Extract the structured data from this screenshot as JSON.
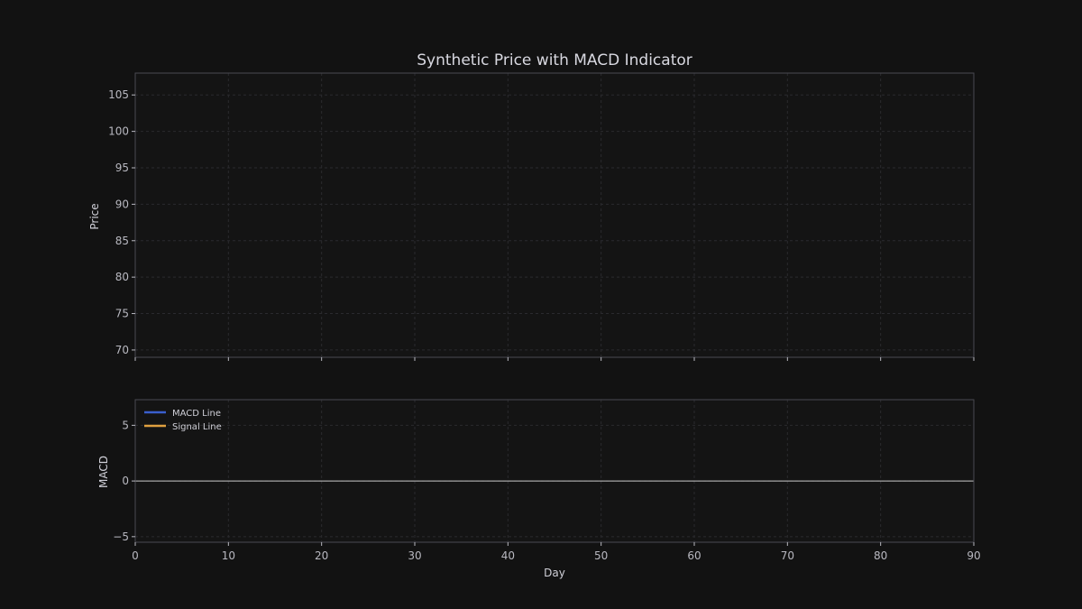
{
  "chart_data": [
    {
      "type": "line",
      "title": "Synthetic Price with MACD Indicator",
      "ylabel": "Price",
      "xlim": [
        0,
        90
      ],
      "ylim": [
        69,
        108
      ],
      "x_ticks": [
        0,
        10,
        20,
        30,
        40,
        50,
        60,
        70,
        80,
        90
      ],
      "y_ticks": [
        70,
        75,
        80,
        85,
        90,
        95,
        100,
        105
      ],
      "grid": true,
      "series": []
    },
    {
      "type": "line",
      "xlabel": "Day",
      "ylabel": "MACD",
      "xlim": [
        0,
        90
      ],
      "ylim": [
        -5.5,
        7.3
      ],
      "x_ticks": [
        0,
        10,
        20,
        30,
        40,
        50,
        60,
        70,
        80,
        90
      ],
      "y_ticks": [
        -5,
        0,
        5
      ],
      "grid": true,
      "zero_line": 0,
      "legend": {
        "placement": "top-left",
        "entries": [
          {
            "name": "MACD Line",
            "color": "#3a5fcd"
          },
          {
            "name": "Signal Line",
            "color": "#e0a040"
          }
        ]
      },
      "series": []
    }
  ],
  "colors": {
    "background": "#121212",
    "axes_face": "#141414",
    "frame": "#4a4a52",
    "grid": "#2a2a2e",
    "tick_text": "#b8b8c0",
    "label_text": "#d0d0d8",
    "zero_line": "#c8c8c8"
  }
}
